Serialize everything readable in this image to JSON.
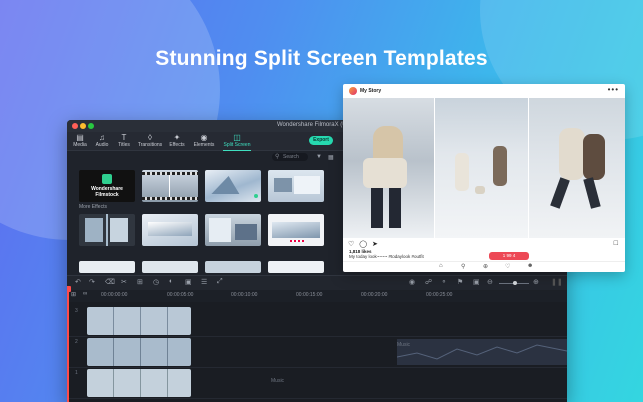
{
  "headline": "Stunning Split Screen Templates",
  "editor": {
    "app_title": "Wondershare FilmoraX (Untit",
    "tools": [
      {
        "label": "Media",
        "icon": "folder-icon"
      },
      {
        "label": "Audio",
        "icon": "music-note-icon"
      },
      {
        "label": "Titles",
        "icon": "text-icon"
      },
      {
        "label": "Transitions",
        "icon": "transition-icon"
      },
      {
        "label": "Effects",
        "icon": "effects-icon"
      },
      {
        "label": "Elements",
        "icon": "elements-icon"
      },
      {
        "label": "Split Screen",
        "icon": "split-screen-icon"
      }
    ],
    "export_label": "Export",
    "search_placeholder": "Search",
    "filmstock_label": "Wondershare Filmstock",
    "more_effects_label": "More Effects",
    "ruler_marks": [
      "00:00:00:00",
      "00:00:05:00",
      "00:00:10:00",
      "00:00:15:00",
      "00:00:20:00",
      "00:00:25:00"
    ],
    "track_numbers": [
      "3",
      "2",
      "1"
    ],
    "audio_labels": [
      "Music",
      "Music"
    ]
  },
  "instagram": {
    "username": "My Story",
    "likes": "1,818 likes",
    "caption": "My today look~~~~ #todaylook #outfit",
    "notification": "1  99  4"
  },
  "colors": {
    "accent": "#26d9b0",
    "playhead": "#ff4b4b",
    "notification": "#ed4956"
  }
}
